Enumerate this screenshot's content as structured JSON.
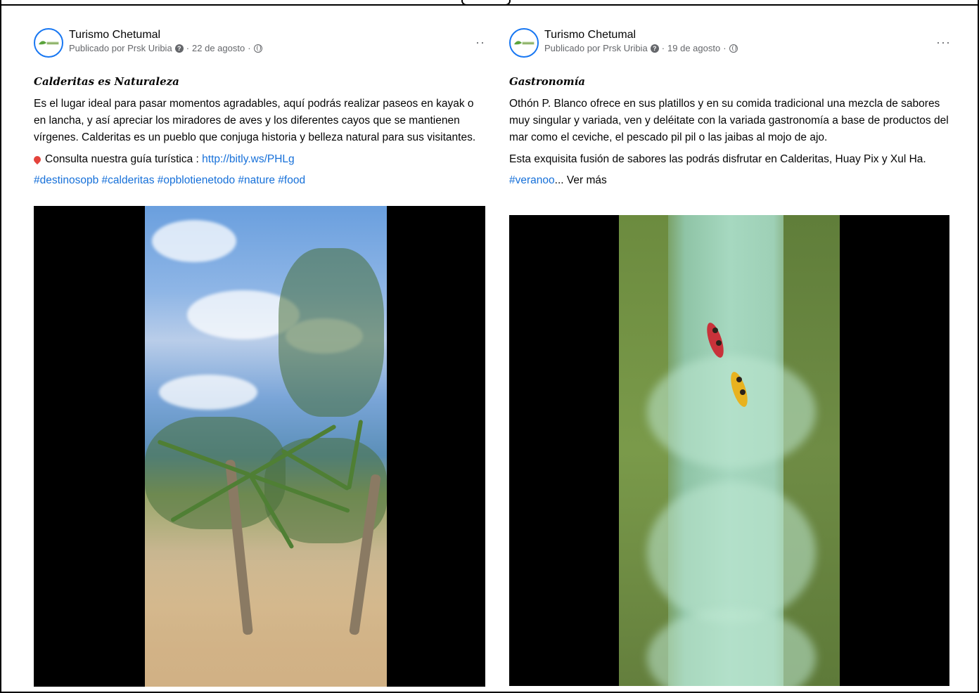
{
  "posts": [
    {
      "page_name": "Turismo Chetumal",
      "byline_prefix": "Publicado por Prsk Uribia",
      "date": "22 de agosto",
      "title": "Calderitas es Naturaleza",
      "body": "Es el lugar ideal para pasar momentos agradables, aquí podrás realizar paseos en kayak o en lancha, y así apreciar los miradores de aves y los diferentes cayos que se mantienen vírgenes. Calderitas es un pueblo que conjuga historia y belleza natural para sus visitantes.",
      "guide_text": "Consulta nuestra guía turística : ",
      "guide_link": "http://bitly.ws/PHLg",
      "hashtags": "#destinosopb #calderitas #opblotienetodo #nature #food",
      "more_icon": "··"
    },
    {
      "page_name": "Turismo Chetumal",
      "byline_prefix": "Publicado por Prsk Uribia",
      "date": "19 de agosto",
      "title": "Gastronomía",
      "body": "Othón P. Blanco ofrece en sus platillos y en su comida tradicional una mezcla de sabores muy singular y variada, ven y deléitate con la variada gastronomía a base de productos del mar como el ceviche, el pescado pil pil o las jaibas al mojo de ajo.",
      "body2": "Esta exquisita fusión de sabores las podrás disfrutar en Calderitas, Huay Pix y Xul Ha.",
      "hashtag": "#veranoo",
      "see_more": "... Ver más",
      "more_icon": "···"
    }
  ],
  "separator": " · ",
  "colors": {
    "link": "#1670d9",
    "text": "#050505",
    "secondary": "#65676b",
    "accent": "#1877f2"
  }
}
